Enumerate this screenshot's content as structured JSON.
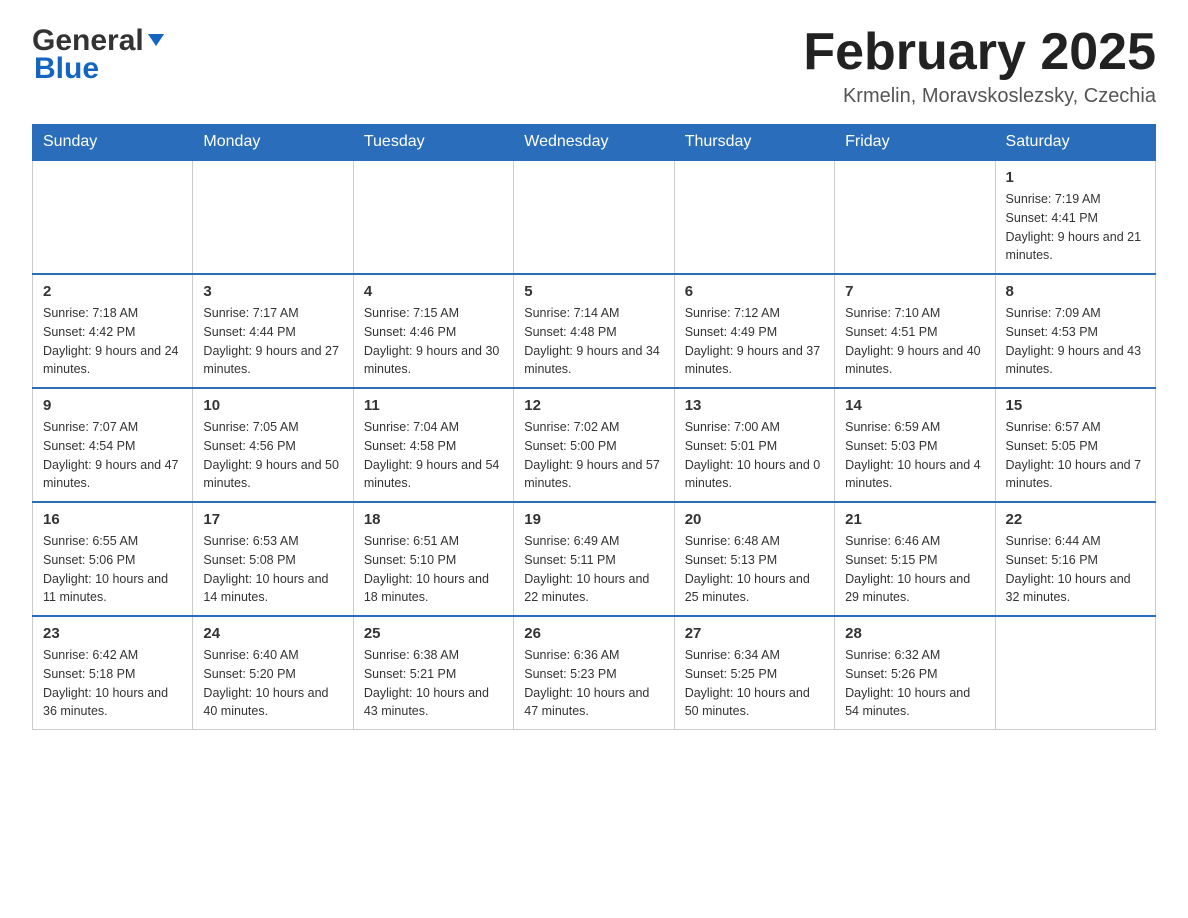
{
  "header": {
    "logo_general": "General",
    "logo_blue": "Blue",
    "month_title": "February 2025",
    "location": "Krmelin, Moravskoslezsky, Czechia"
  },
  "days_of_week": [
    "Sunday",
    "Monday",
    "Tuesday",
    "Wednesday",
    "Thursday",
    "Friday",
    "Saturday"
  ],
  "weeks": [
    {
      "days": [
        {
          "number": "",
          "info": ""
        },
        {
          "number": "",
          "info": ""
        },
        {
          "number": "",
          "info": ""
        },
        {
          "number": "",
          "info": ""
        },
        {
          "number": "",
          "info": ""
        },
        {
          "number": "",
          "info": ""
        },
        {
          "number": "1",
          "info": "Sunrise: 7:19 AM\nSunset: 4:41 PM\nDaylight: 9 hours and 21 minutes."
        }
      ]
    },
    {
      "days": [
        {
          "number": "2",
          "info": "Sunrise: 7:18 AM\nSunset: 4:42 PM\nDaylight: 9 hours and 24 minutes."
        },
        {
          "number": "3",
          "info": "Sunrise: 7:17 AM\nSunset: 4:44 PM\nDaylight: 9 hours and 27 minutes."
        },
        {
          "number": "4",
          "info": "Sunrise: 7:15 AM\nSunset: 4:46 PM\nDaylight: 9 hours and 30 minutes."
        },
        {
          "number": "5",
          "info": "Sunrise: 7:14 AM\nSunset: 4:48 PM\nDaylight: 9 hours and 34 minutes."
        },
        {
          "number": "6",
          "info": "Sunrise: 7:12 AM\nSunset: 4:49 PM\nDaylight: 9 hours and 37 minutes."
        },
        {
          "number": "7",
          "info": "Sunrise: 7:10 AM\nSunset: 4:51 PM\nDaylight: 9 hours and 40 minutes."
        },
        {
          "number": "8",
          "info": "Sunrise: 7:09 AM\nSunset: 4:53 PM\nDaylight: 9 hours and 43 minutes."
        }
      ]
    },
    {
      "days": [
        {
          "number": "9",
          "info": "Sunrise: 7:07 AM\nSunset: 4:54 PM\nDaylight: 9 hours and 47 minutes."
        },
        {
          "number": "10",
          "info": "Sunrise: 7:05 AM\nSunset: 4:56 PM\nDaylight: 9 hours and 50 minutes."
        },
        {
          "number": "11",
          "info": "Sunrise: 7:04 AM\nSunset: 4:58 PM\nDaylight: 9 hours and 54 minutes."
        },
        {
          "number": "12",
          "info": "Sunrise: 7:02 AM\nSunset: 5:00 PM\nDaylight: 9 hours and 57 minutes."
        },
        {
          "number": "13",
          "info": "Sunrise: 7:00 AM\nSunset: 5:01 PM\nDaylight: 10 hours and 0 minutes."
        },
        {
          "number": "14",
          "info": "Sunrise: 6:59 AM\nSunset: 5:03 PM\nDaylight: 10 hours and 4 minutes."
        },
        {
          "number": "15",
          "info": "Sunrise: 6:57 AM\nSunset: 5:05 PM\nDaylight: 10 hours and 7 minutes."
        }
      ]
    },
    {
      "days": [
        {
          "number": "16",
          "info": "Sunrise: 6:55 AM\nSunset: 5:06 PM\nDaylight: 10 hours and 11 minutes."
        },
        {
          "number": "17",
          "info": "Sunrise: 6:53 AM\nSunset: 5:08 PM\nDaylight: 10 hours and 14 minutes."
        },
        {
          "number": "18",
          "info": "Sunrise: 6:51 AM\nSunset: 5:10 PM\nDaylight: 10 hours and 18 minutes."
        },
        {
          "number": "19",
          "info": "Sunrise: 6:49 AM\nSunset: 5:11 PM\nDaylight: 10 hours and 22 minutes."
        },
        {
          "number": "20",
          "info": "Sunrise: 6:48 AM\nSunset: 5:13 PM\nDaylight: 10 hours and 25 minutes."
        },
        {
          "number": "21",
          "info": "Sunrise: 6:46 AM\nSunset: 5:15 PM\nDaylight: 10 hours and 29 minutes."
        },
        {
          "number": "22",
          "info": "Sunrise: 6:44 AM\nSunset: 5:16 PM\nDaylight: 10 hours and 32 minutes."
        }
      ]
    },
    {
      "days": [
        {
          "number": "23",
          "info": "Sunrise: 6:42 AM\nSunset: 5:18 PM\nDaylight: 10 hours and 36 minutes."
        },
        {
          "number": "24",
          "info": "Sunrise: 6:40 AM\nSunset: 5:20 PM\nDaylight: 10 hours and 40 minutes."
        },
        {
          "number": "25",
          "info": "Sunrise: 6:38 AM\nSunset: 5:21 PM\nDaylight: 10 hours and 43 minutes."
        },
        {
          "number": "26",
          "info": "Sunrise: 6:36 AM\nSunset: 5:23 PM\nDaylight: 10 hours and 47 minutes."
        },
        {
          "number": "27",
          "info": "Sunrise: 6:34 AM\nSunset: 5:25 PM\nDaylight: 10 hours and 50 minutes."
        },
        {
          "number": "28",
          "info": "Sunrise: 6:32 AM\nSunset: 5:26 PM\nDaylight: 10 hours and 54 minutes."
        },
        {
          "number": "",
          "info": ""
        }
      ]
    }
  ]
}
